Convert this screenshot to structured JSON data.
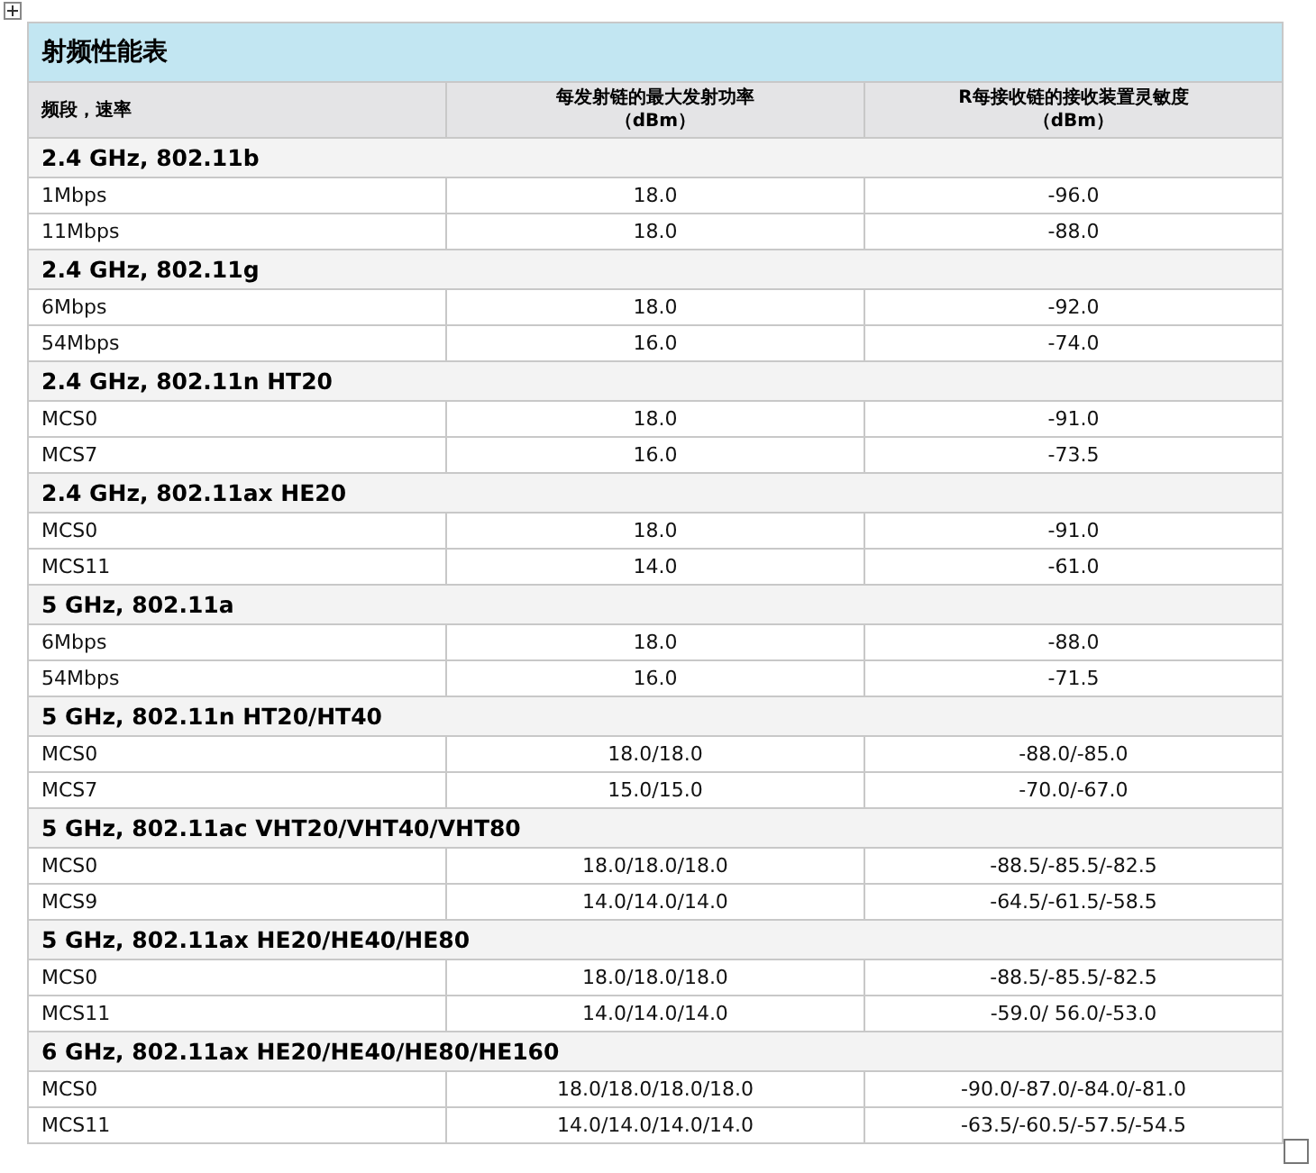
{
  "title": "射频性能表",
  "columns": [
    {
      "lines": [
        "频段，速率"
      ]
    },
    {
      "lines": [
        "每发射链的最大发射功率",
        "（dBm）"
      ]
    },
    {
      "lines": [
        "R每接收链的接收装置灵敏度",
        "（dBm）"
      ]
    }
  ],
  "groups": [
    {
      "name": "2.4 GHz, 802.11b",
      "rows": [
        [
          "1Mbps",
          "18.0",
          "-96.0"
        ],
        [
          "11Mbps",
          "18.0",
          "-88.0"
        ]
      ]
    },
    {
      "name": "2.4 GHz, 802.11g",
      "rows": [
        [
          "6Mbps",
          "18.0",
          "-92.0"
        ],
        [
          "54Mbps",
          "16.0",
          "-74.0"
        ]
      ]
    },
    {
      "name": "2.4 GHz, 802.11n HT20",
      "rows": [
        [
          "MCS0",
          "18.0",
          "-91.0"
        ],
        [
          "MCS7",
          "16.0",
          "-73.5"
        ]
      ]
    },
    {
      "name": "2.4 GHz, 802.11ax HE20",
      "rows": [
        [
          "MCS0",
          "18.0",
          "-91.0"
        ],
        [
          "MCS11",
          "14.0",
          "-61.0"
        ]
      ]
    },
    {
      "name": "5 GHz, 802.11a",
      "rows": [
        [
          "6Mbps",
          "18.0",
          "-88.0"
        ],
        [
          "54Mbps",
          "16.0",
          "-71.5"
        ]
      ]
    },
    {
      "name": "5 GHz, 802.11n HT20/HT40",
      "rows": [
        [
          "MCS0",
          "18.0/18.0",
          "-88.0/-85.0"
        ],
        [
          "MCS7",
          "15.0/15.0",
          "-70.0/-67.0"
        ]
      ]
    },
    {
      "name": "5 GHz, 802.11ac VHT20/VHT40/VHT80",
      "rows": [
        [
          "MCS0",
          "18.0/18.0/18.0",
          "-88.5/-85.5/-82.5"
        ],
        [
          "MCS9",
          "14.0/14.0/14.0",
          "-64.5/-61.5/-58.5"
        ]
      ]
    },
    {
      "name": "5 GHz, 802.11ax HE20/HE40/HE80",
      "rows": [
        [
          "MCS0",
          "18.0/18.0/18.0",
          "-88.5/-85.5/-82.5"
        ],
        [
          "MCS11",
          "14.0/14.0/14.0",
          "-59.0/ 56.0/-53.0"
        ]
      ]
    },
    {
      "name": "6 GHz, 802.11ax HE20/HE40/HE80/HE160",
      "rows": [
        [
          "MCS0",
          "18.0/18.0/18.0/18.0",
          "-90.0/-87.0/-84.0/-81.0"
        ],
        [
          "MCS11",
          "14.0/14.0/14.0/14.0",
          "-63.5/-60.5/-57.5/-54.5"
        ]
      ]
    }
  ]
}
